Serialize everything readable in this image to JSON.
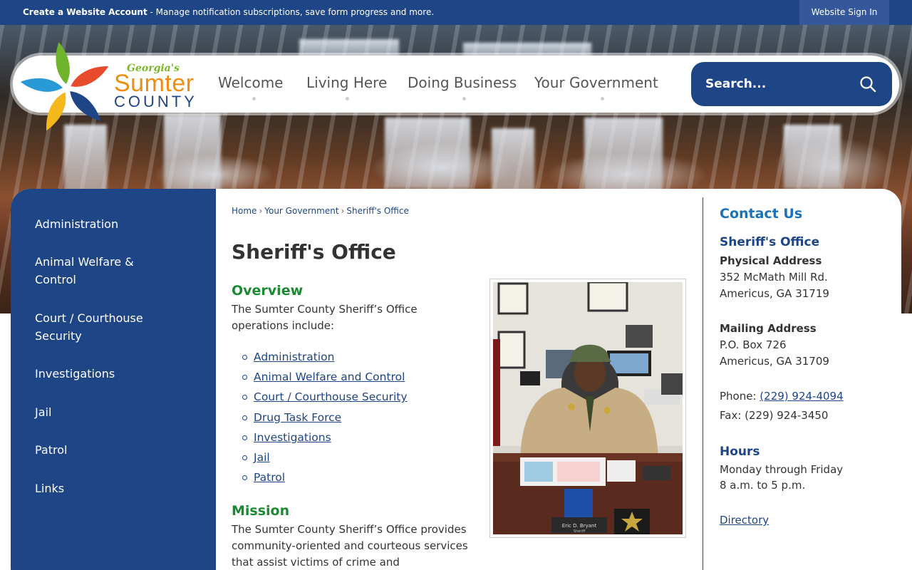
{
  "topbar": {
    "account_link": "Create a Website Account",
    "account_desc": " - Manage notification subscriptions, save form progress and more.",
    "signin": "Website Sign In"
  },
  "logo": {
    "georgias": "Georgia's",
    "sumter": "Sumter",
    "county": "COUNTY"
  },
  "nav": [
    {
      "label": "Welcome"
    },
    {
      "label": "Living Here"
    },
    {
      "label": "Doing Business"
    },
    {
      "label": "Your Government"
    }
  ],
  "search": {
    "placeholder": "Search..."
  },
  "sidebar": {
    "items": [
      {
        "label": "Administration"
      },
      {
        "label": "Animal Welfare & Control"
      },
      {
        "label": "Court / Courthouse Security"
      },
      {
        "label": "Investigations"
      },
      {
        "label": "Jail"
      },
      {
        "label": "Patrol"
      },
      {
        "label": "Links"
      }
    ]
  },
  "breadcrumb": [
    "Home",
    "Your Government",
    "Sheriff's Office"
  ],
  "page_title": "Sheriff's Office",
  "overview": {
    "heading": "Overview",
    "text": "The Sumter County Sheriff’s Office operations include:",
    "links": [
      "Administration",
      "Animal Welfare and Control",
      "Court / Courthouse Security",
      "Drug Task Force",
      "Investigations",
      "Jail",
      "Patrol"
    ]
  },
  "mission": {
    "heading": "Mission",
    "text": "The Sumter County Sheriff’s Office provides community-oriented and courteous services that assist victims of crime and"
  },
  "photo": {
    "nameplate": "Eric D. Bryant",
    "nameplate_title": "Sheriff"
  },
  "contact": {
    "heading": "Contact Us",
    "office": "Sheriff's Office",
    "physical_label": "Physical Address",
    "physical_line1": "352 McMath Mill Rd.",
    "physical_line2": "Americus, GA 31719",
    "mailing_label": "Mailing Address",
    "mailing_line1": "P.O. Box 726",
    "mailing_line2": "Americus, GA 31709",
    "phone_label": "Phone: ",
    "phone": "(229) 924-4094",
    "fax": "Fax: (229) 924-3450",
    "hours_heading": "Hours",
    "hours_line1": "Monday through Friday",
    "hours_line2": "8 a.m. to 5 p.m.",
    "directory": "Directory"
  },
  "colors": {
    "navy": "#1e4586",
    "green": "#1d8a33",
    "blue": "#1b72b8",
    "orange": "#f08c10"
  }
}
